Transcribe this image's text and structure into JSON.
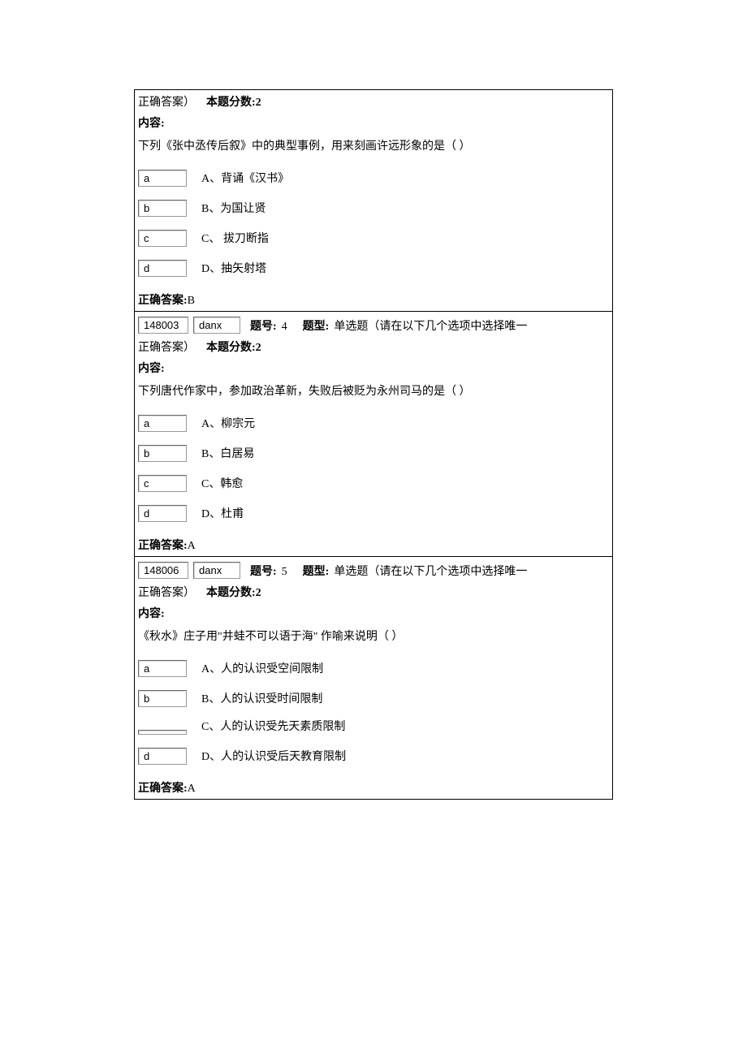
{
  "labels": {
    "correct_answer_paren": "正确答案）",
    "score_label": "本题分数:",
    "content_label": "内容:",
    "correct_answer_label": "正确答案:",
    "q_number_label": "题号:",
    "q_type_label": "题型:"
  },
  "questions": [
    {
      "score": "2",
      "content_text": "下列《张中丞传后叙》中的典型事例，用来刻画许远形象的是（  ）",
      "options": [
        {
          "letter": "a",
          "label": "A、背诵《汉书》"
        },
        {
          "letter": "b",
          "label": "B、为国让贤"
        },
        {
          "letter": "c",
          "label": "C、 拔刀断指"
        },
        {
          "letter": "d",
          "label": "D、抽矢射塔"
        }
      ],
      "answer": "B"
    },
    {
      "qid": "148003",
      "qtype": "danx",
      "q_number": "4",
      "q_type_text": "单选题（请在以下几个选项中选择唯一",
      "score": "2",
      "content_text": "下列唐代作家中，参加政治革新，失败后被贬为永州司马的是（  ）",
      "options": [
        {
          "letter": "a",
          "label": "A、柳宗元"
        },
        {
          "letter": "b",
          "label": "B、白居易"
        },
        {
          "letter": "c",
          "label": "C、韩愈"
        },
        {
          "letter": "d",
          "label": "D、杜甫"
        }
      ],
      "answer": "A"
    },
    {
      "qid": "148006",
      "qtype": "danx",
      "q_number": "5",
      "q_type_text": "单选题（请在以下几个选项中选择唯一",
      "score": "2",
      "content_text": "《秋水》庄子用\"井蛙不可以语于海\" 作喻来说明（  ）",
      "options": [
        {
          "letter": "a",
          "label": "A、人的认识受空间限制"
        },
        {
          "letter": "b",
          "label": "B、人的认识受时间限制"
        },
        {
          "letter": "",
          "label": "C、人的认识受先天素质限制"
        },
        {
          "letter": "d",
          "label": "D、人的认识受后天教育限制"
        }
      ],
      "answer": "A"
    }
  ]
}
